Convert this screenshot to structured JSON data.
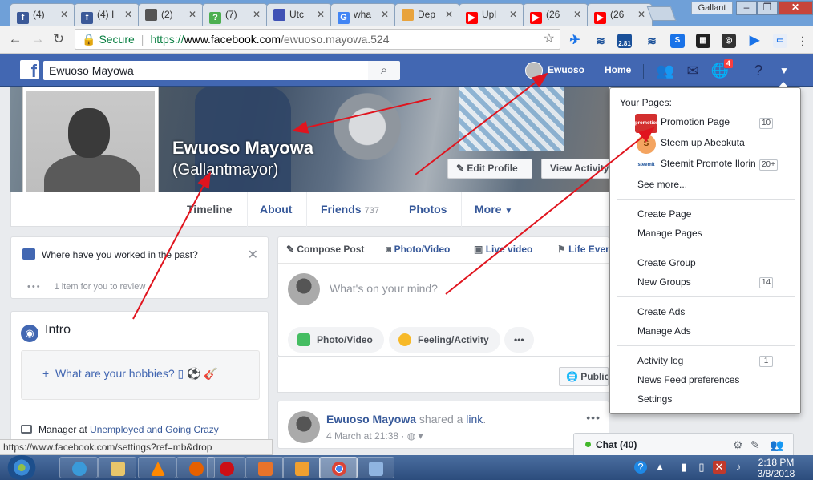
{
  "browser": {
    "tabs": [
      {
        "label": "(4)",
        "favicon_color": "#3b5998",
        "glyph": "f",
        "active": false
      },
      {
        "label": "(4) I",
        "favicon_color": "#3b5998",
        "glyph": "f",
        "active": false
      },
      {
        "label": "(2)",
        "favicon_color": "#555555",
        "glyph": "",
        "active": false
      },
      {
        "label": "(7)",
        "favicon_color": "#4caf50",
        "glyph": "?",
        "active": false
      },
      {
        "label": "Utc",
        "favicon_color": "#3f51b5",
        "glyph": "",
        "active": false
      },
      {
        "label": "wha",
        "favicon_color": "#4285f4",
        "glyph": "G",
        "active": false
      },
      {
        "label": "Dep",
        "favicon_color": "#e8a33d",
        "glyph": "",
        "active": false
      },
      {
        "label": "Upl",
        "favicon_color": "#ff0000",
        "glyph": "▶",
        "active": false
      },
      {
        "label": "(26",
        "favicon_color": "#ff0000",
        "glyph": "▶",
        "active": false
      },
      {
        "label": "(26",
        "favicon_color": "#ff0000",
        "glyph": "▶",
        "active": false
      }
    ],
    "user_badge": "Gallant",
    "secure_label": "Secure",
    "url_scheme": "https://",
    "url_domain": "www.facebook.com",
    "url_path": "/ewuoso.mayowa.524",
    "extension_badge": "2.81"
  },
  "fb": {
    "search_value": "Ewuoso Mayowa",
    "profile_link": "Ewuoso",
    "home_link": "Home",
    "notification_count": "4",
    "brand_color": "#4267b2"
  },
  "profile": {
    "name": "Ewuoso Mayowa",
    "alternate_name": "(Gallantmayor)",
    "edit_profile": "Edit Profile",
    "view_activity": "View Activity",
    "nav": {
      "timeline": "Timeline",
      "about": "About",
      "friends": "Friends",
      "friends_count": "737",
      "photos": "Photos",
      "more": "More"
    }
  },
  "work_card": {
    "question": "Where have you worked in the past?",
    "review": "1 item for you to review"
  },
  "intro": {
    "title": "Intro",
    "hobbies_link": "What are your hobbies? ▯ ⚽ 🎸",
    "manager_prefix": "Manager at ",
    "manager_link": "Unemployed and Going Crazy"
  },
  "composer": {
    "compose_post": "Compose Post",
    "photo_video_tab": "Photo/Video",
    "live_video": "Live video",
    "life_event": "Life Event",
    "placeholder": "What's on your mind?",
    "photo_video_pill": "Photo/Video",
    "feeling_activity": "Feeling/Activity",
    "public_button": "Public"
  },
  "post": {
    "author": "Ewuoso Mayowa",
    "action": " shared a ",
    "link_text": "link",
    "period": ".",
    "time": "4 March at 21:38 · "
  },
  "dropdown": {
    "header": "Your Pages:",
    "pages": [
      {
        "name": "Promotion Page",
        "badge": "10",
        "pic_text": "promotion",
        "pic_color": "#d32f2f"
      },
      {
        "name": "Steem up Abeokuta",
        "badge": "",
        "pic_text": "S",
        "pic_color": "#f4a460"
      },
      {
        "name": "Steemit Promote Ilorin",
        "badge": "20+",
        "pic_text": "steemit",
        "pic_color": "#1a5099"
      }
    ],
    "see_more": "See more...",
    "create_page": "Create Page",
    "manage_pages": "Manage Pages",
    "create_group": "Create Group",
    "new_groups": "New Groups",
    "new_groups_badge": "14",
    "create_ads": "Create Ads",
    "manage_ads": "Manage Ads",
    "activity_log": "Activity log",
    "activity_log_badge": "1",
    "news_feed_prefs": "News Feed preferences",
    "settings": "Settings"
  },
  "chat": {
    "label": "Chat (40)"
  },
  "status_url": "https://www.facebook.com/settings?ref=mb&drop",
  "taskbar": {
    "time": "2:18 PM",
    "date": "3/8/2018"
  }
}
